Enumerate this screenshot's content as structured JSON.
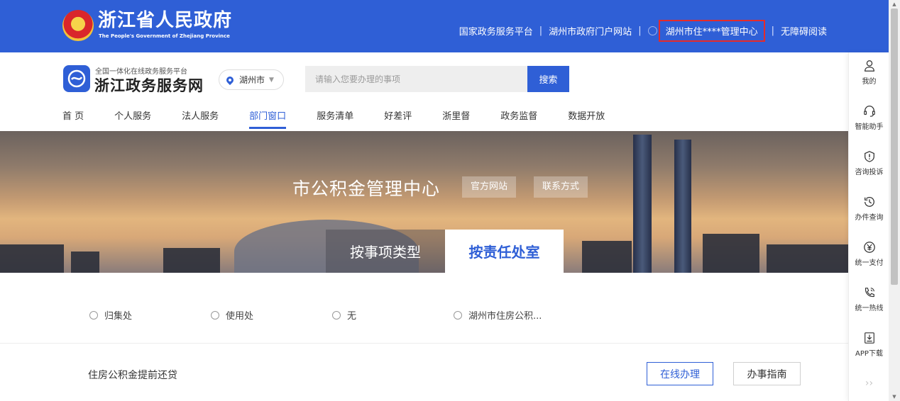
{
  "topbar": {
    "site_title": "浙江省人民政府",
    "site_subtitle": "The People's Government of Zhejiang Province",
    "links": [
      "国家政务服务平台",
      "湖州市政府门户网站"
    ],
    "user_label": "湖州市住****管理中心",
    "accessibility": "无障碍阅读"
  },
  "header": {
    "logo_small": "全国一体化在线政务服务平台",
    "logo_big": "浙江政务服务网",
    "city": "湖州市",
    "search_placeholder": "请输入您要办理的事项",
    "search_button": "搜索",
    "nav": [
      "首 页",
      "个人服务",
      "法人服务",
      "部门窗口",
      "服务清单",
      "好差评",
      "浙里督",
      "政务监督",
      "数据开放"
    ],
    "nav_active": "部门窗口"
  },
  "banner": {
    "title": "市公积金管理中心",
    "tag_website": "官方网站",
    "tag_contact": "联系方式",
    "tab_by_type": "按事项类型",
    "tab_by_office": "按责任处室"
  },
  "filters": [
    "归集处",
    "使用处",
    "无",
    "湖州市住房公积..."
  ],
  "list": {
    "item_title": "住房公积金提前还贷",
    "btn_online": "在线办理",
    "btn_guide": "办事指南"
  },
  "rightbar": [
    {
      "label": "我的",
      "icon": "user-icon"
    },
    {
      "label": "智能助手",
      "icon": "headset-icon"
    },
    {
      "label": "咨询投诉",
      "icon": "shield-alert-icon"
    },
    {
      "label": "办件查询",
      "icon": "history-icon"
    },
    {
      "label": "统一支付",
      "icon": "yuan-icon"
    },
    {
      "label": "统一热线",
      "icon": "phone-icon"
    },
    {
      "label": "APP下载",
      "icon": "download-icon"
    }
  ],
  "colors": {
    "brand_blue": "#2f5fd6",
    "highlight_red": "#e52a2a"
  }
}
